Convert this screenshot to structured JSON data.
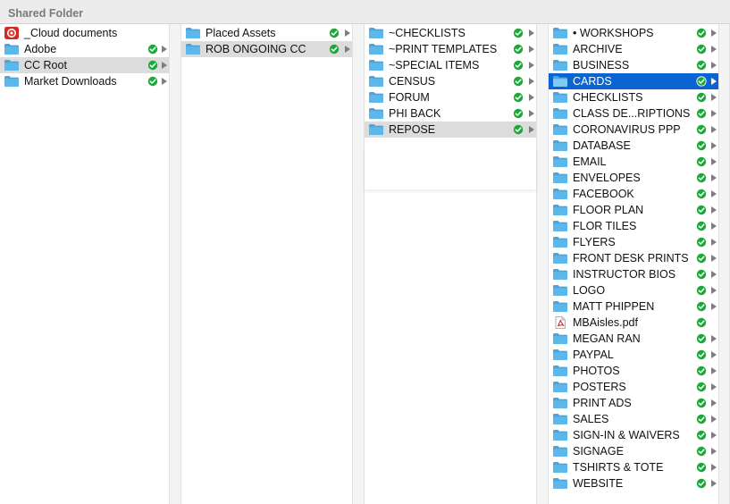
{
  "header": {
    "title": "Shared Folder"
  },
  "columns": [
    {
      "items": [
        {
          "label": "_Cloud documents",
          "icon": "creative-cloud-icon",
          "status": false,
          "arrow": false
        },
        {
          "label": "Adobe",
          "icon": "folder-icon",
          "status": true,
          "arrow": true
        },
        {
          "label": "CC Root",
          "icon": "folder-icon",
          "status": true,
          "arrow": true,
          "state": "selected"
        },
        {
          "label": "Market Downloads",
          "icon": "folder-icon",
          "status": true,
          "arrow": true
        }
      ]
    },
    {
      "items": [
        {
          "label": "Placed Assets",
          "icon": "folder-icon",
          "status": true,
          "arrow": true
        },
        {
          "label": "ROB ONGOING CC",
          "icon": "folder-icon",
          "status": true,
          "arrow": true,
          "state": "selected"
        }
      ]
    },
    {
      "items": [
        {
          "label": "~CHECKLISTS",
          "icon": "folder-icon",
          "status": true,
          "arrow": true
        },
        {
          "label": "~PRINT TEMPLATES",
          "icon": "folder-icon",
          "status": true,
          "arrow": true
        },
        {
          "label": "~SPECIAL ITEMS",
          "icon": "folder-icon",
          "status": true,
          "arrow": true
        },
        {
          "label": "CENSUS",
          "icon": "folder-icon",
          "status": true,
          "arrow": true
        },
        {
          "label": "FORUM",
          "icon": "folder-icon",
          "status": true,
          "arrow": true
        },
        {
          "label": "PHI BACK",
          "icon": "folder-icon",
          "status": true,
          "arrow": true
        },
        {
          "label": "REPOSE",
          "icon": "folder-icon",
          "status": true,
          "arrow": true,
          "state": "selected"
        }
      ]
    },
    {
      "items": [
        {
          "label": "• WORKSHOPS",
          "icon": "folder-icon",
          "status": true,
          "arrow": true
        },
        {
          "label": "ARCHIVE",
          "icon": "folder-icon",
          "status": true,
          "arrow": true
        },
        {
          "label": "BUSINESS",
          "icon": "folder-icon",
          "status": true,
          "arrow": true
        },
        {
          "label": "CARDS",
          "icon": "folder-icon",
          "status": true,
          "arrow": true,
          "state": "active"
        },
        {
          "label": "CHECKLISTS",
          "icon": "folder-icon",
          "status": true,
          "arrow": true
        },
        {
          "label": "CLASS DE...RIPTIONS",
          "icon": "folder-icon",
          "status": true,
          "arrow": true
        },
        {
          "label": "CORONAVIRUS PPP",
          "icon": "folder-icon",
          "status": true,
          "arrow": true
        },
        {
          "label": "DATABASE",
          "icon": "folder-icon",
          "status": true,
          "arrow": true
        },
        {
          "label": "EMAIL",
          "icon": "folder-icon",
          "status": true,
          "arrow": true
        },
        {
          "label": "ENVELOPES",
          "icon": "folder-icon",
          "status": true,
          "arrow": true
        },
        {
          "label": "FACEBOOK",
          "icon": "folder-icon",
          "status": true,
          "arrow": true
        },
        {
          "label": "FLOOR PLAN",
          "icon": "folder-icon",
          "status": true,
          "arrow": true
        },
        {
          "label": "FLOR TILES",
          "icon": "folder-icon",
          "status": true,
          "arrow": true
        },
        {
          "label": "FLYERS",
          "icon": "folder-icon",
          "status": true,
          "arrow": true
        },
        {
          "label": "FRONT DESK PRINTS",
          "icon": "folder-icon",
          "status": true,
          "arrow": true
        },
        {
          "label": "INSTRUCTOR BIOS",
          "icon": "folder-icon",
          "status": true,
          "arrow": true
        },
        {
          "label": "LOGO",
          "icon": "folder-icon",
          "status": true,
          "arrow": true
        },
        {
          "label": "MATT PHIPPEN",
          "icon": "folder-icon",
          "status": true,
          "arrow": true
        },
        {
          "label": "MBAisles.pdf",
          "icon": "pdf-file-icon",
          "status": true,
          "arrow": false
        },
        {
          "label": "MEGAN RAN",
          "icon": "folder-icon",
          "status": true,
          "arrow": true
        },
        {
          "label": "PAYPAL",
          "icon": "folder-icon",
          "status": true,
          "arrow": true
        },
        {
          "label": "PHOTOS",
          "icon": "folder-icon",
          "status": true,
          "arrow": true
        },
        {
          "label": "POSTERS",
          "icon": "folder-icon",
          "status": true,
          "arrow": true
        },
        {
          "label": "PRINT ADS",
          "icon": "folder-icon",
          "status": true,
          "arrow": true
        },
        {
          "label": "SALES",
          "icon": "folder-icon",
          "status": true,
          "arrow": true
        },
        {
          "label": "SIGN-IN & WAIVERS",
          "icon": "folder-icon",
          "status": true,
          "arrow": true
        },
        {
          "label": "SIGNAGE",
          "icon": "folder-icon",
          "status": true,
          "arrow": true
        },
        {
          "label": "TSHIRTS & TOTE",
          "icon": "folder-icon",
          "status": true,
          "arrow": true
        },
        {
          "label": "WEBSITE",
          "icon": "folder-icon",
          "status": true,
          "arrow": true
        }
      ]
    }
  ],
  "colors": {
    "folder": "#5cb8ea",
    "folder_tab": "#49a6dc",
    "synced": "#1ea83a",
    "selection": "#dcdcdc",
    "active_selection": "#0a64d2",
    "cloud": "#d52a24",
    "pdf": "#d92b2b"
  }
}
